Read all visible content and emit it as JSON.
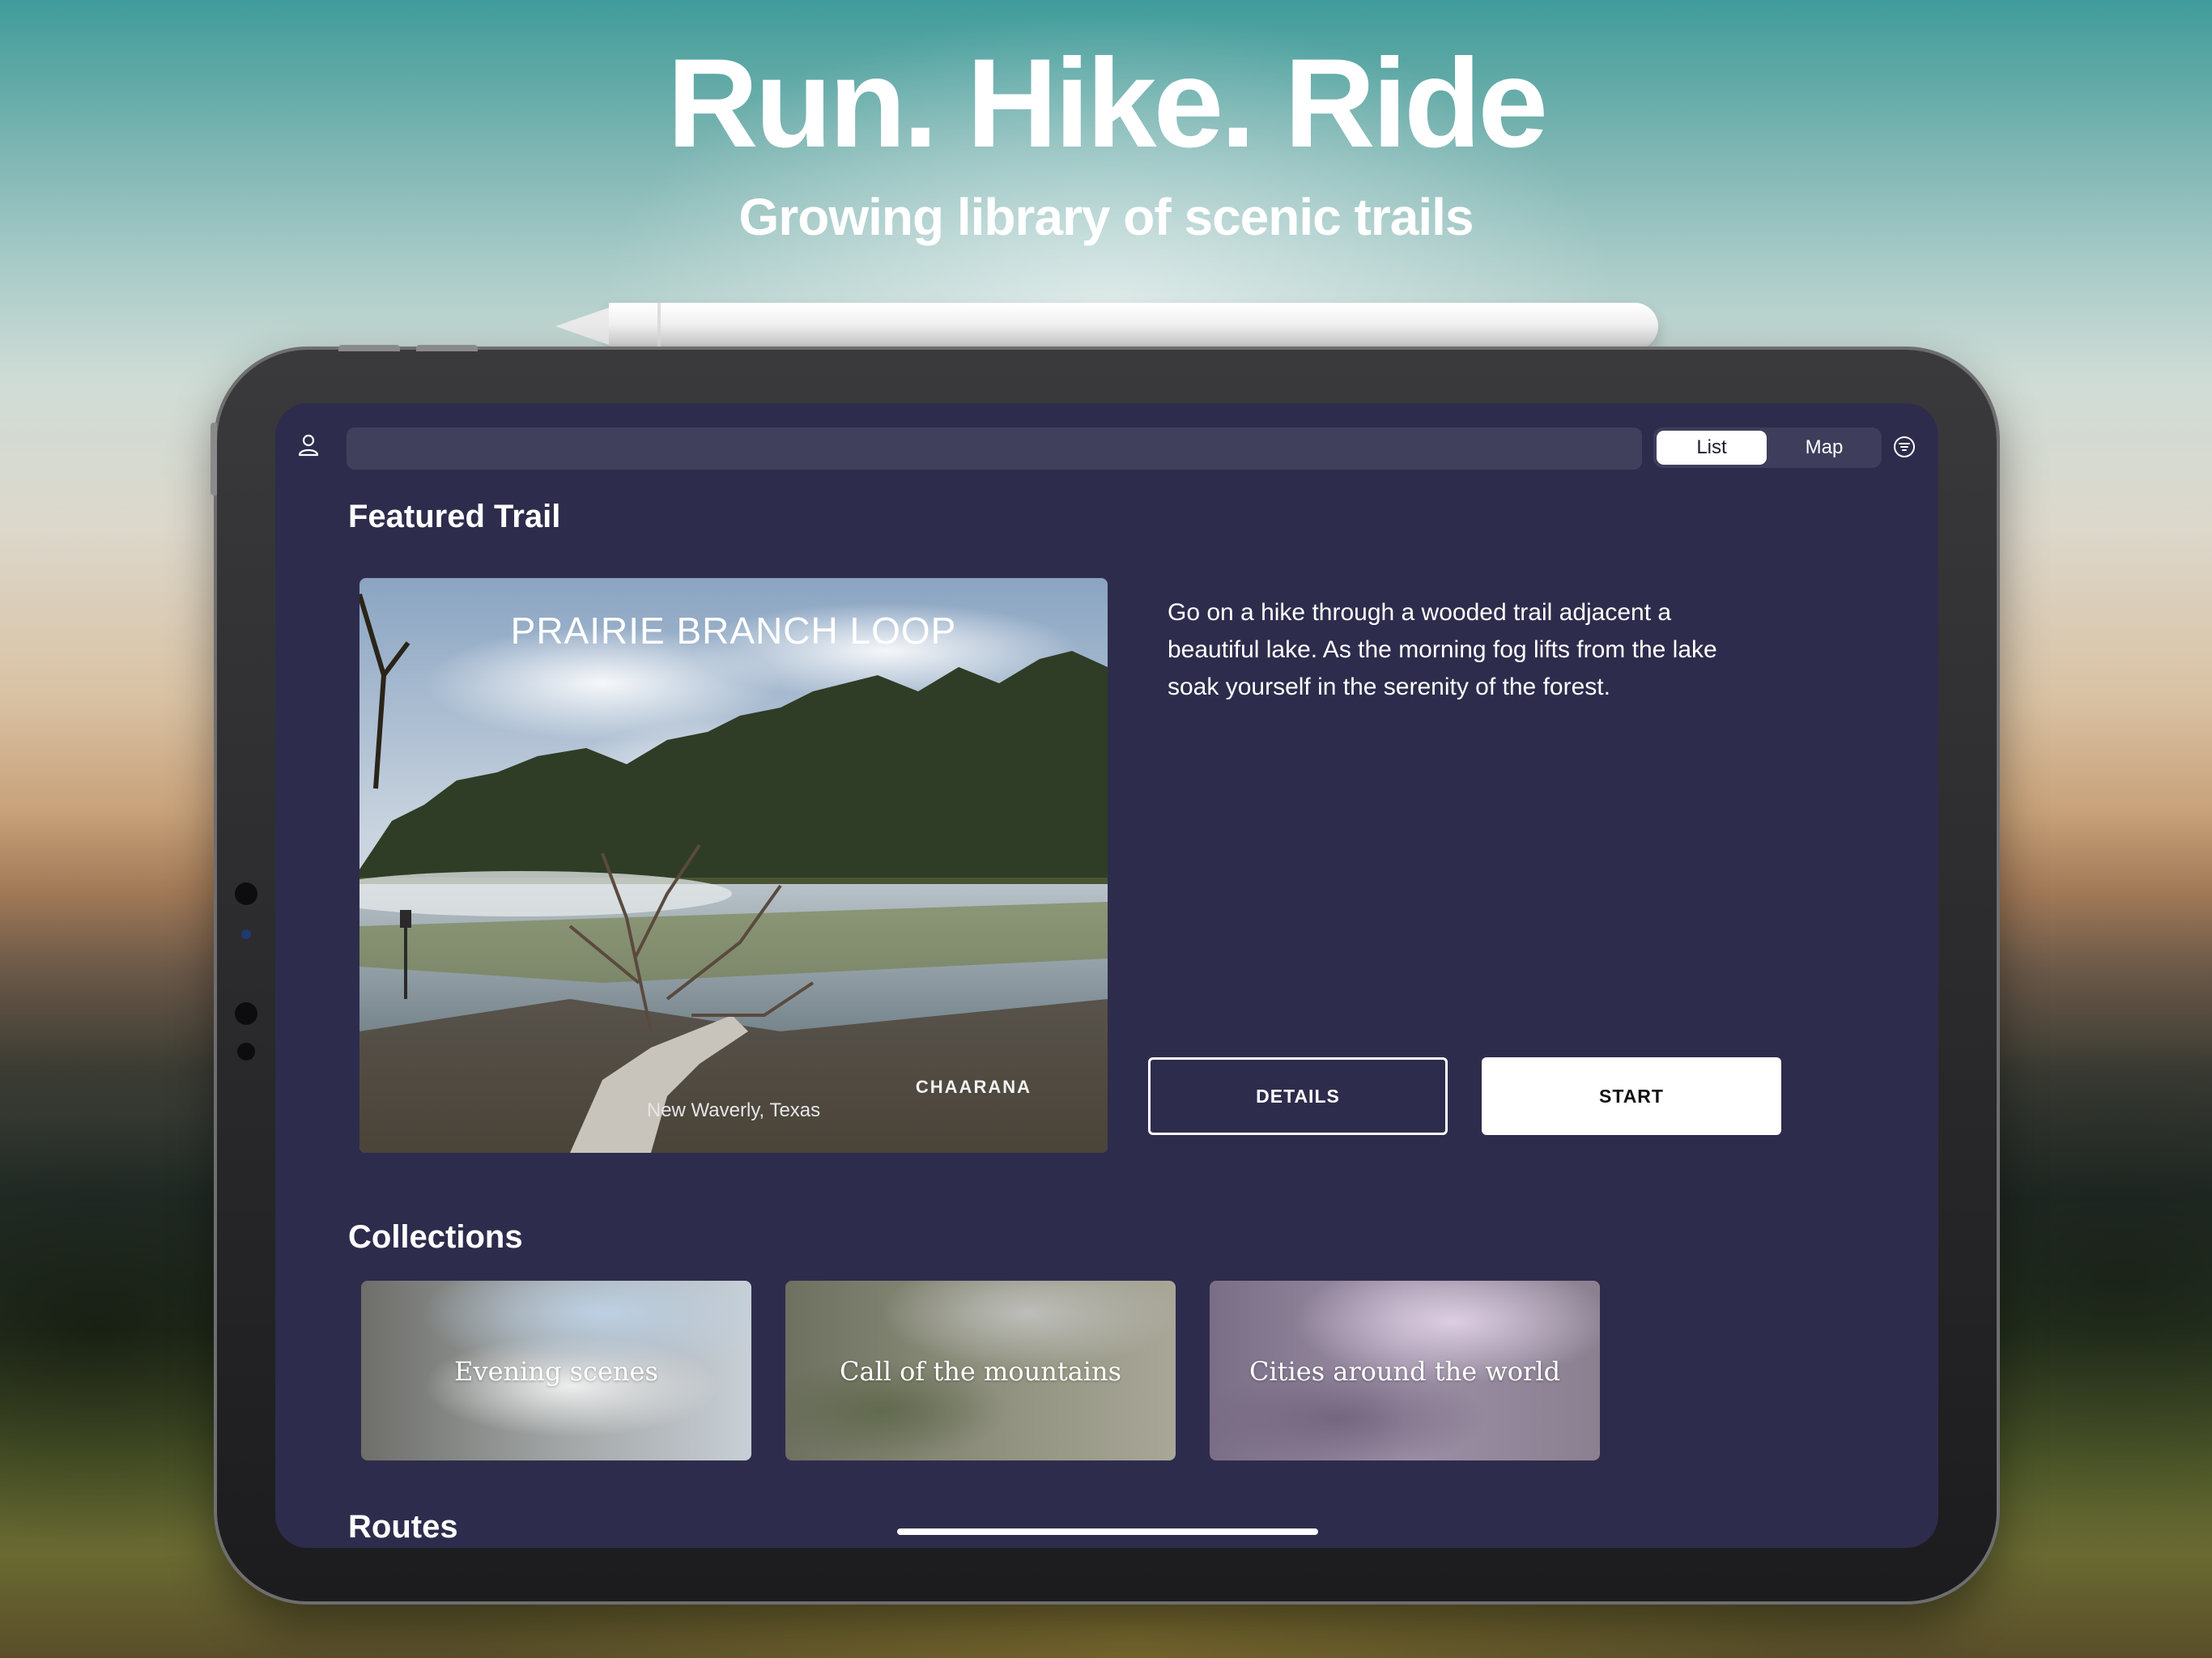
{
  "hero": {
    "title": "Run. Hike. Ride",
    "subtitle": "Growing library of scenic trails"
  },
  "toolbar": {
    "search_placeholder": "",
    "view_modes": [
      "List",
      "Map"
    ],
    "active_view": "List",
    "icons": [
      "person-icon",
      "filter-icon"
    ]
  },
  "featured": {
    "section_title": "Featured Trail",
    "trail_name": "PRAIRIE BRANCH LOOP",
    "location": "New Waverly, Texas",
    "brand": "CHAARANA",
    "description": "Go on a hike through a wooded trail adjacent a beautiful lake. As the morning fog lifts from the lake soak yourself in the serenity of the forest.",
    "details_label": "DETAILS",
    "start_label": "START"
  },
  "collections": {
    "section_title": "Collections",
    "items": [
      {
        "label": "Evening scenes"
      },
      {
        "label": "Call of the mountains"
      },
      {
        "label": "Cities around the world"
      }
    ]
  },
  "routes": {
    "section_title": "Routes"
  },
  "colors": {
    "screen_bg": "#2e2c4c",
    "search_bg": "#403f5c",
    "accent": "#ffffff"
  }
}
